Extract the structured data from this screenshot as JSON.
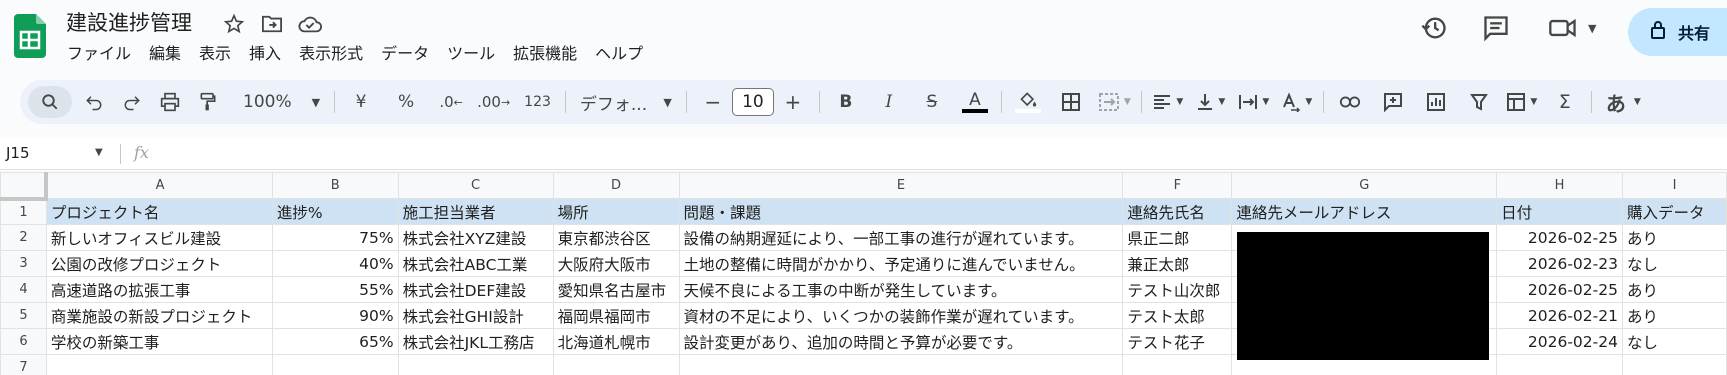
{
  "doc": {
    "title": "建設進捗管理"
  },
  "menu": [
    "ファイル",
    "編集",
    "表示",
    "挿入",
    "表示形式",
    "データ",
    "ツール",
    "拡張機能",
    "ヘルプ"
  ],
  "share_label": "共有",
  "toolbar": {
    "zoom": "100%",
    "currency": "¥",
    "percent": "%",
    "dec_decrease": ".0",
    "dec_increase": ".00",
    "number_format": "123",
    "font": "デフォ...",
    "font_size": "10",
    "minus": "−",
    "plus": "+",
    "bold": "B",
    "italic": "I",
    "strike": "S",
    "text_color": "A",
    "input_tools": "あ"
  },
  "formula": {
    "cell_ref": "J15",
    "fx": "fx"
  },
  "columns": [
    "A",
    "B",
    "C",
    "D",
    "E",
    "F",
    "G",
    "H",
    "I"
  ],
  "rows": [
    {
      "n": "1",
      "cells": [
        "プロジェクト名",
        "進捗%",
        "施工担当業者",
        "場所",
        "問題・課題",
        "連絡先氏名",
        "連絡先メールアドレス",
        "日付",
        "購入データ"
      ]
    },
    {
      "n": "2",
      "cells": [
        "新しいオフィスビル建設",
        "75%",
        "株式会社XYZ建設",
        "東京都渋谷区",
        "設備の納期遅延により、一部工事の進行が遅れています。",
        "県正二郎",
        "",
        "2026-02-25",
        "あり"
      ]
    },
    {
      "n": "3",
      "cells": [
        "公園の改修プロジェクト",
        "40%",
        "株式会社ABC工業",
        "大阪府大阪市",
        "土地の整備に時間がかかり、予定通りに進んでいません。",
        "兼正太郎",
        "",
        "2026-02-23",
        "なし"
      ]
    },
    {
      "n": "4",
      "cells": [
        "高速道路の拡張工事",
        "55%",
        "株式会社DEF建設",
        "愛知県名古屋市",
        "天候不良による工事の中断が発生しています。",
        "テスト山次郎",
        "",
        "2026-02-25",
        "あり"
      ]
    },
    {
      "n": "5",
      "cells": [
        "商業施設の新設プロジェクト",
        "90%",
        "株式会社GHI設計",
        "福岡県福岡市",
        "資材の不足により、いくつかの装飾作業が遅れています。",
        "テスト太郎",
        "",
        "2026-02-21",
        "あり"
      ]
    },
    {
      "n": "6",
      "cells": [
        "学校の新築工事",
        "65%",
        "株式会社JKL工務店",
        "北海道札幌市",
        "設計変更があり、追加の時間と予算が必要です。",
        "テスト花子",
        "",
        "2026-02-24",
        "なし"
      ]
    },
    {
      "n": "7",
      "cells": [
        "",
        "",
        "",
        "",
        "",
        "",
        "",
        "",
        ""
      ]
    }
  ]
}
